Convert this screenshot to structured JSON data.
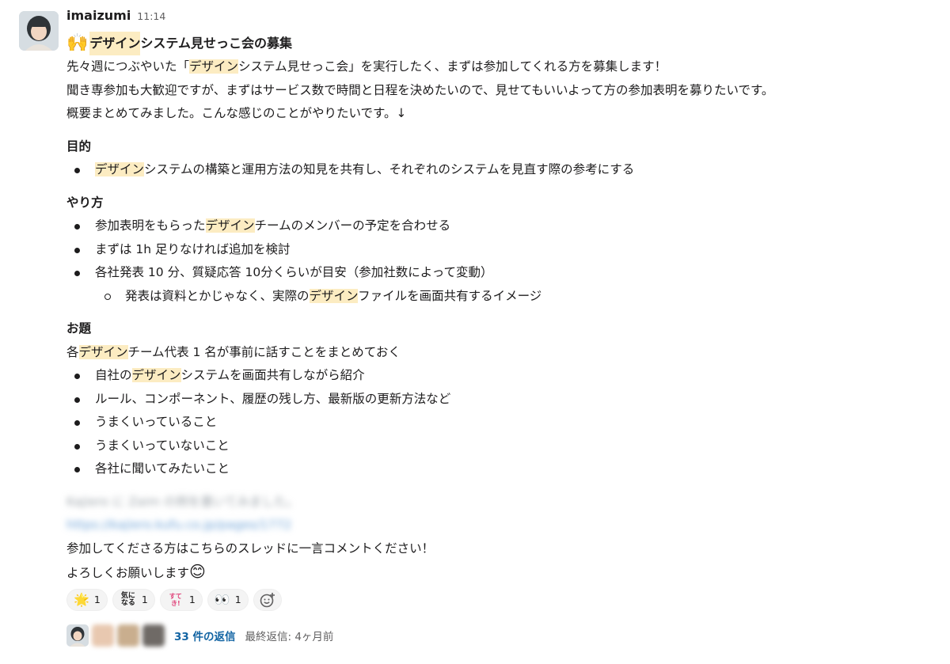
{
  "message": {
    "user": "imaizumi",
    "time": "11:14",
    "title_emoji": "🙌",
    "title_hl": "デザイン",
    "title_rest": "システム見せっこ会の募集",
    "p1_pre": "先々週につぶやいた「",
    "p1_hl": "デザイン",
    "p1_post": "システム見せっこ会」を実行したく、まずは参加してくれる方を募集します！",
    "p2": "聞き専参加も大歓迎ですが、まずはサービス数で時間と日程を決めたいので、見せてもいいよって方の参加表明を募りたいです。",
    "p3": "概要まとめてみました。こんな感じのことがやりたいです。↓",
    "h_purpose": "目的",
    "purpose_hl": "デザイン",
    "purpose_rest": "システムの構築と運用方法の知見を共有し、それぞれのシステムを見直す際の参考にする",
    "h_method": "やり方",
    "m1_pre": "参加表明をもらった",
    "m1_hl": "デザイン",
    "m1_post": "チームのメンバーの予定を合わせる",
    "m2": "まずは 1h 足りなければ追加を検討",
    "m3": "各社発表 10 分、質疑応答 10分くらいが目安（参加社数によって変動）",
    "m3a_pre": "発表は資料とかじゃなく、実際の",
    "m3a_hl": "デザイン",
    "m3a_post": "ファイルを画面共有するイメージ",
    "h_topic": "お題",
    "t0_pre": "各",
    "t0_hl": "デザイン",
    "t0_post": "チーム代表 1 名が事前に話すことをまとめておく",
    "t1_pre": "自社の",
    "t1_hl": "デザイン",
    "t1_post": "システムを画面共有しながら紹介",
    "t2": "ルール、コンポーネント、履歴の残し方、最新版の更新方法など",
    "t3": "うまくいっていること",
    "t4": "うまくいっていないこと",
    "t5": "各社に聞いてみたいこと",
    "blur1": "Kajiero に Zaim の例を書いてみました。",
    "blur2": "https://kajiero.kufu.co.jp/pages/1772",
    "p4": "参加してくださる方はこちらのスレッドに一言コメントください！",
    "p5": "よろしくお願いします",
    "p5_emoji": "😊"
  },
  "reactions": [
    {
      "emoji": "🌟",
      "count": "1"
    },
    {
      "badge": "気に\nなる",
      "count": "1"
    },
    {
      "badge": "すてき!",
      "count": "1"
    },
    {
      "emoji": "👀",
      "count": "1"
    }
  ],
  "add_reaction_icon": "add-reaction-icon",
  "thread": {
    "count": "33 件の返信",
    "last": "最終返信: 4ヶ月前"
  }
}
